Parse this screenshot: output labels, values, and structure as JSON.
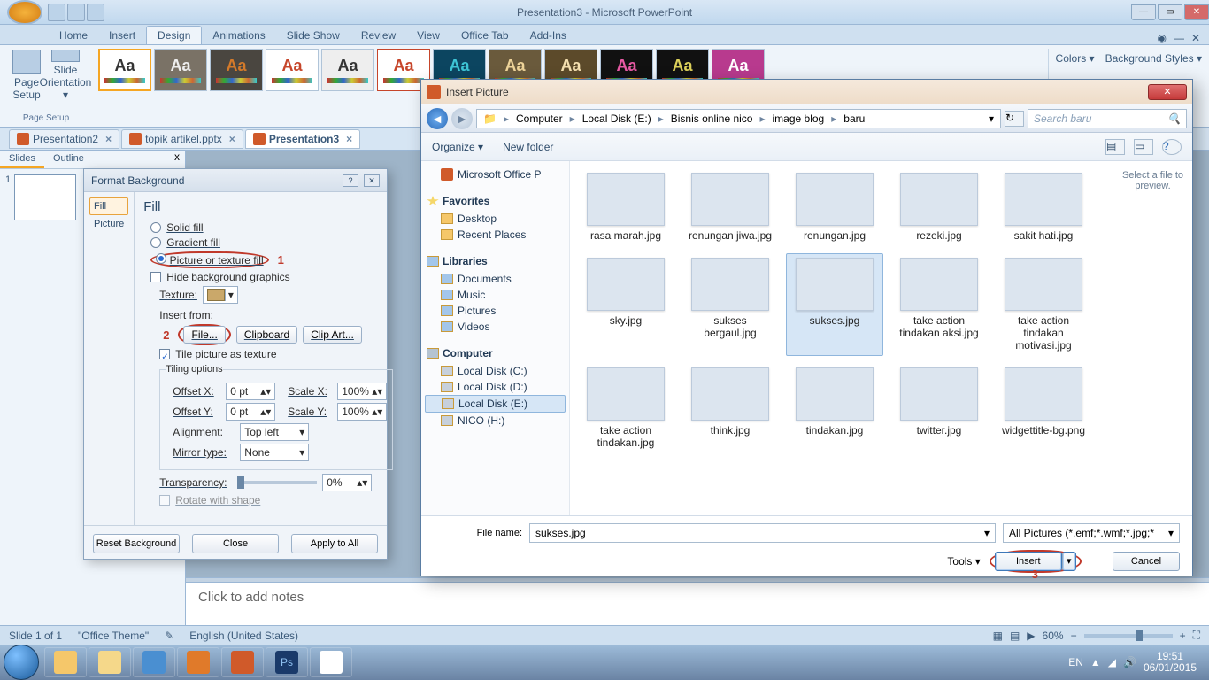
{
  "window": {
    "title": "Presentation3 - Microsoft PowerPoint"
  },
  "ribbon": {
    "tabs": [
      "Home",
      "Insert",
      "Design",
      "Animations",
      "Slide Show",
      "Review",
      "View",
      "Office Tab",
      "Add-Ins"
    ],
    "active": "Design",
    "page_setup_group": "Page Setup",
    "page_setup_btn": "Page Setup",
    "orientation_btn": "Slide Orientation ▾",
    "colors": "Colors ▾",
    "bg_styles": "Background Styles ▾"
  },
  "doctabs": {
    "t1": "Presentation2",
    "t2": "topik artikel.pptx",
    "t3": "Presentation3"
  },
  "panel": {
    "slides": "Slides",
    "outline": "Outline"
  },
  "notes_placeholder": "Click to add notes",
  "status": {
    "slide": "Slide 1 of 1",
    "theme": "\"Office Theme\"",
    "lang": "English (United States)",
    "zoom": "60%"
  },
  "format_bg": {
    "title": "Format Background",
    "nav_fill": "Fill",
    "nav_picture": "Picture",
    "heading": "Fill",
    "solid": "Solid fill",
    "gradient": "Gradient fill",
    "pictex": "Picture or texture fill",
    "hide": "Hide background graphics",
    "texture_lbl": "Texture:",
    "insert_from": "Insert from:",
    "file_btn": "File...",
    "clipboard_btn": "Clipboard",
    "clipart_btn": "Clip Art...",
    "tile": "Tile picture as texture",
    "tiling_opts": "Tiling options",
    "offx": "Offset X:",
    "offy": "Offset Y:",
    "offx_val": "0 pt",
    "offy_val": "0 pt",
    "scalex": "Scale X:",
    "scaley": "Scale Y:",
    "scalex_val": "100%",
    "scaley_val": "100%",
    "align": "Alignment:",
    "align_val": "Top left",
    "mirror": "Mirror type:",
    "mirror_val": "None",
    "transp": "Transparency:",
    "transp_val": "0%",
    "rotate": "Rotate with shape",
    "reset": "Reset Background",
    "close": "Close",
    "apply_all": "Apply to All",
    "anno1": "1",
    "anno2": "2"
  },
  "insert_pic": {
    "title": "Insert Picture",
    "crumb": [
      "Computer",
      "Local Disk (E:)",
      "Bisnis online nico",
      "image blog",
      "baru"
    ],
    "search_ph": "Search baru",
    "organize": "Organize ▾",
    "newfolder": "New folder",
    "office_section": "Microsoft Office P",
    "fav": "Favorites",
    "desktop": "Desktop",
    "recent": "Recent Places",
    "libs": "Libraries",
    "docs": "Documents",
    "music": "Music",
    "pics": "Pictures",
    "vids": "Videos",
    "computer": "Computer",
    "drvC": "Local Disk (C:)",
    "drvD": "Local Disk (D:)",
    "drvE": "Local Disk (E:)",
    "drvH": "NICO (H:)",
    "preview_txt": "Select a file to preview.",
    "filename_lbl": "File name:",
    "filename_val": "sukses.jpg",
    "filter": "All Pictures (*.emf;*.wmf;*.jpg;*",
    "tools": "Tools ▾",
    "insert": "Insert",
    "cancel": "Cancel",
    "anno3": "3",
    "files": [
      "rasa marah.jpg",
      "renungan jiwa.jpg",
      "renungan.jpg",
      "rezeki.jpg",
      "sakit hati.jpg",
      "sky.jpg",
      "sukses bergaul.jpg",
      "sukses.jpg",
      "take action tindakan aksi.jpg",
      "take action tindakan motivasi.jpg",
      "take action tindakan.jpg",
      "think.jpg",
      "tindakan.jpg",
      "twitter.jpg",
      "widgettitle-bg.png"
    ]
  },
  "tray": {
    "lang": "EN",
    "time": "19:51",
    "date": "06/01/2015"
  }
}
